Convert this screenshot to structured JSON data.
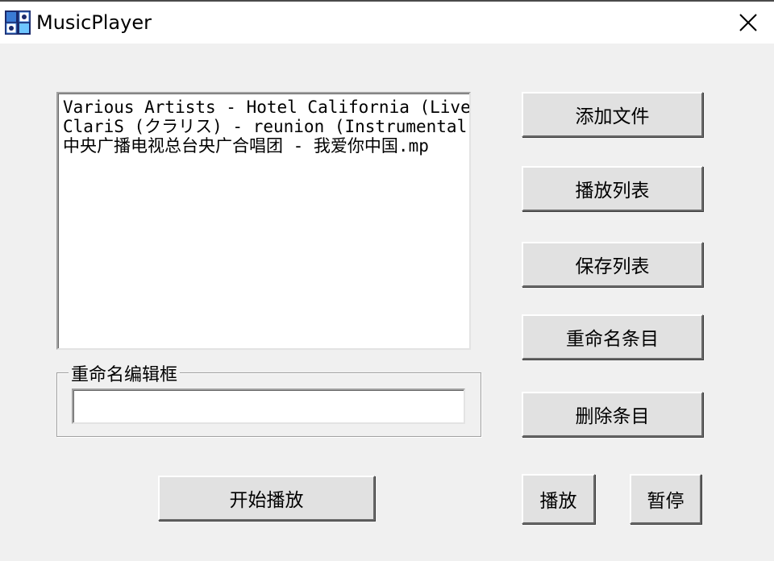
{
  "window": {
    "title": "MusicPlayer",
    "app_icon": "music-player-app-icon",
    "close_icon": "close-icon"
  },
  "playlist": {
    "items": [
      "Various Artists - Hotel California (Live).",
      "ClariS (クラリス) - reunion (Instrumental)",
      "中央广播电视总台央广合唱团 - 我爱你中国.mp"
    ]
  },
  "rename_group": {
    "label": "重命名编辑框",
    "value": "",
    "placeholder": ""
  },
  "buttons": {
    "add_file": "添加文件",
    "play_list": "播放列表",
    "save_list": "保存列表",
    "rename_item": "重命名条目",
    "delete_item": "删除条目",
    "start_play": "开始播放",
    "play": "播放",
    "pause": "暂停"
  }
}
